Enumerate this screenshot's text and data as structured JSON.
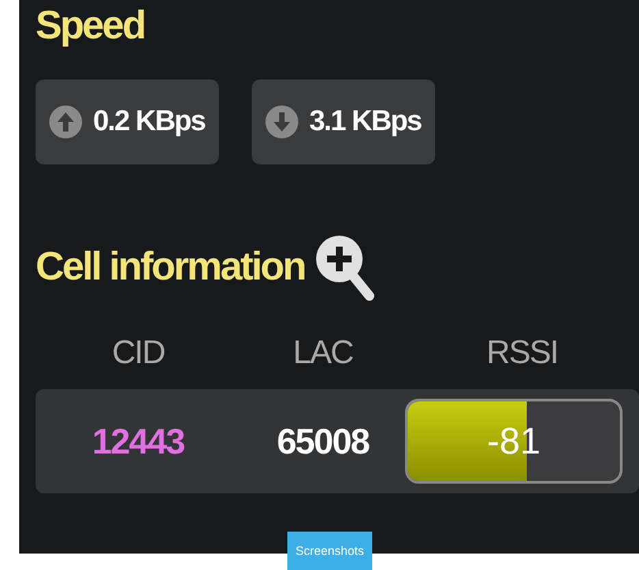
{
  "speed": {
    "title": "Speed",
    "rates": [
      {
        "kind": "up",
        "value": "0.2 KBps"
      },
      {
        "kind": "down",
        "value": "3.1 KBps"
      }
    ]
  },
  "cell_information": {
    "title": "Cell information",
    "columns": [
      "CID",
      "LAC",
      "RSSI"
    ],
    "cid": {
      "value": "12443",
      "color": "#e070e0"
    },
    "lac": {
      "value": "65008",
      "color": "#ffffff"
    },
    "rssi": {
      "level": 0.56,
      "reading": "-81"
    }
  },
  "label": "Screenshots"
}
